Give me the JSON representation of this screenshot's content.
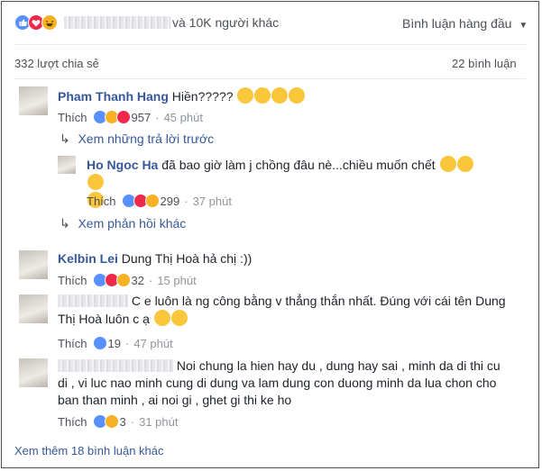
{
  "post_footer": {
    "reactions_text": "và 10K người khác",
    "sort_label": "Bình luận hàng đầu",
    "shares": "332 lượt chia sẻ",
    "comments_count": "22 bình luận"
  },
  "comments": [
    {
      "author": "Pham Thanh Hang",
      "text": "Hiền?????",
      "like_label": "Thích",
      "reaction_count": "957",
      "time": "45 phút"
    },
    {
      "author": "Kelbin Lei",
      "text": "Dung Thị Hoà hả chị :))",
      "like_label": "Thích",
      "reaction_count": "32",
      "time": "15 phút"
    },
    {
      "author": "",
      "text": "C e luôn là ng công bằng v thẳng thắn nhất. Đúng với cái tên Dung Thị Hoà luôn c ạ",
      "like_label": "Thích",
      "reaction_count": "19",
      "time": "47 phút"
    },
    {
      "author": "",
      "text": "Noi chung la hien hay du , dung hay sai , minh da di thi cu di , vi luc nao minh cung di dung va lam dung con duong minh da lua chon cho ban than minh , ai noi gi , ghet gi thi ke ho",
      "like_label": "Thích",
      "reaction_count": "3",
      "time": "31 phút"
    }
  ],
  "replies": {
    "previous_link": "Xem những trả lời trước",
    "reply": {
      "author": "Ho Ngoc Ha",
      "text": "đã bao giờ làm j chồng đâu nè...chiều muốn chết",
      "like_label": "Thích",
      "reaction_count": "299",
      "time": "37 phút"
    },
    "more_link": "Xem phản hồi khác"
  },
  "more_comments": "Xem thêm 18 bình luận khác",
  "colors": {
    "link": "#365899",
    "muted": "#90949c",
    "like": "#5890ff",
    "love": "#f0284a",
    "haha": "#f7b125"
  }
}
